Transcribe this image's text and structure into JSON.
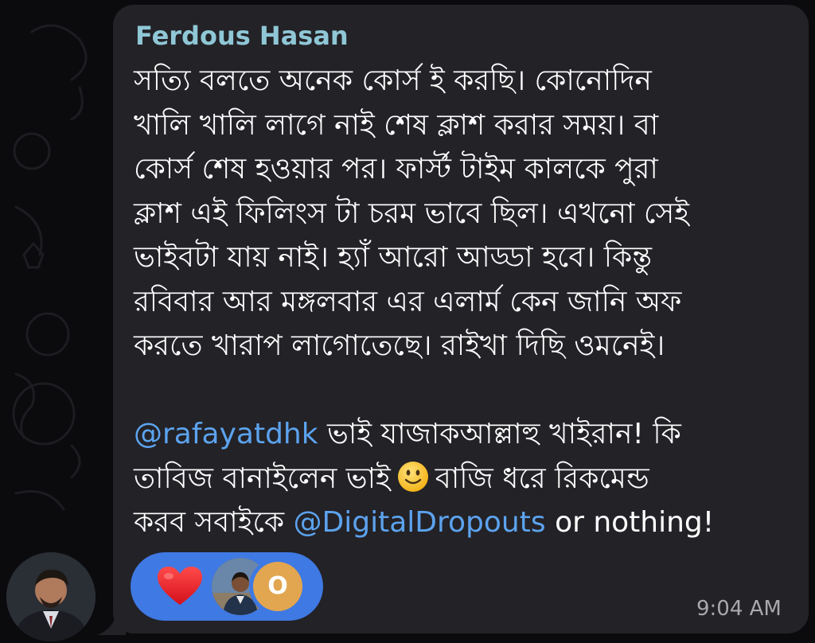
{
  "message": {
    "sender": "Ferdous Hasan",
    "lines": [
      "সত্যি বলতে অনেক কোর্স ই করছি। কোনোদিন",
      "খালি খালি লাগে নাই শেষ ক্লাশ করার সময়। বা",
      "কোর্স শেষ হওয়ার পর। ফার্স্ট টাইম কালকে পুরা",
      "ক্লাশ এই ফিলিংস টা চরম ভাবে ছিল। এখনো সেই",
      "ভাইবটা যায় নাই। হ্যাঁ আরো আড্ডা হবে। কিন্তু",
      "রবিবার আর মঙ্গলবার এর এলার্ম কেন জানি অফ",
      "করতে খারাপ লাগোতেছে। রাইখা দিছি ওমনেই।"
    ],
    "para2": {
      "line1_mention": "@rafayatdhk",
      "line1_rest": " ভাই যাজাকআল্লাহু খাইরান! কি",
      "line2_before": "তাবিজ বানাইলেন ভাই",
      "line2_emoji": "slightly-smiling-face-icon",
      "line2_after": "বাজি ধরে রিকমেন্ড",
      "line3_before": "করব সবাইকে ",
      "line3_mention": "@DigitalDropouts",
      "line3_after": " or nothing!"
    },
    "time": "9:04 AM"
  },
  "reactions": {
    "emoji": "heart-icon",
    "reactor_initial": "O",
    "bg_color": "#3f79e3"
  },
  "colors": {
    "bubble": "#232227",
    "sender": "#8fc7d6",
    "mention": "#5ca3ee",
    "text": "#ffffff",
    "time": "#a9a8ad"
  }
}
